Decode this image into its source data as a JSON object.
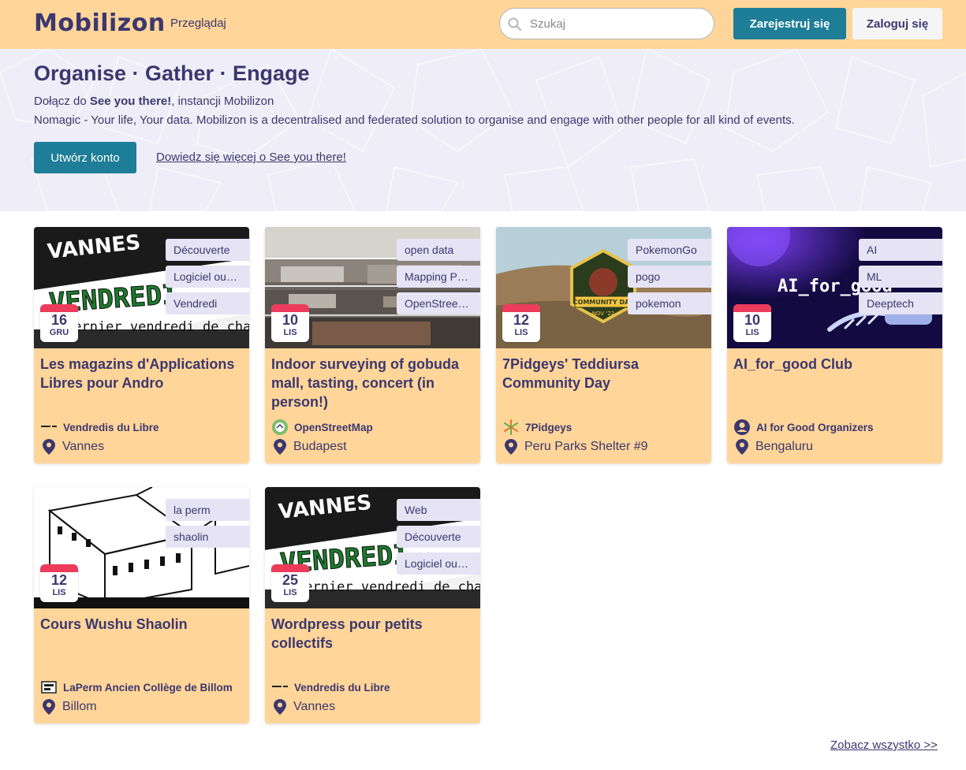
{
  "header": {
    "logo": "Mobilizon",
    "browse_label": "Przeglądaj",
    "search_placeholder": "Szukaj",
    "register_label": "Zarejestruj się",
    "login_label": "Zaloguj się"
  },
  "hero": {
    "title": "Organise · Gather · Engage",
    "join_prefix": "Dołącz do ",
    "instance_name": "See you there!",
    "join_suffix": ", instancji Mobilizon",
    "description": "Nomagic - Your life, Your data. Mobilizon is a decentralised and federated solution to organise and engage with other people for all kind of events.",
    "create_account_label": "Utwórz konto",
    "learn_more_label": "Dowiedz się więcej o See you there!"
  },
  "events": [
    {
      "title": "Les magazins d'Applications Libres pour Andro",
      "day": "16",
      "month": "GRU",
      "tags": [
        "Découverte",
        "Logiciel ou…",
        "Vendredi"
      ],
      "organizer": "Vendredis du Libre",
      "location": "Vannes",
      "image": "vendredi-banner",
      "image_text": [
        "VANNES",
        "VENDREDI",
        "dernier vendredi de chaq"
      ]
    },
    {
      "title": "Indoor surveying of gobuda mall, tasting, concert (in person!)",
      "day": "10",
      "month": "LIS",
      "tags": [
        "open data",
        "Mapping P…",
        "OpenStree…"
      ],
      "organizer": "OpenStreetMap",
      "location": "Budapest",
      "image": "mall-photo"
    },
    {
      "title": "7Pidgeys' Teddiursa Community Day",
      "day": "12",
      "month": "LIS",
      "tags": [
        "PokemonGo",
        "pogo",
        "pokemon"
      ],
      "organizer": "7Pidgeys",
      "location": "Peru Parks Shelter #9",
      "image": "community-day",
      "image_text": [
        "COMMUNITY DAY",
        "NOV '22"
      ]
    },
    {
      "title": "AI_for_good Club",
      "day": "10",
      "month": "LIS",
      "tags": [
        "AI",
        "ML",
        "Deeptech"
      ],
      "organizer": "AI for Good Organizers",
      "location": "Bengaluru",
      "image": "ai-banner",
      "image_text": [
        "AI_for_good"
      ]
    },
    {
      "title": "Cours Wushu Shaolin",
      "day": "12",
      "month": "LIS",
      "tags": [
        "la perm",
        "shaolin"
      ],
      "organizer": "LaPerm Ancien Collège de Billom",
      "location": "Billom",
      "image": "laperm-drawing"
    },
    {
      "title": "Wordpress pour petits collectifs",
      "day": "25",
      "month": "LIS",
      "tags": [
        "Web",
        "Découverte",
        "Logiciel ou…"
      ],
      "organizer": "Vendredis du Libre",
      "location": "Vannes",
      "image": "vendredi-banner",
      "image_text": [
        "VANNES",
        "VENDREDI",
        "dernier vendredi de chaq"
      ]
    }
  ],
  "see_all_label": "Zobacz wszystko >>",
  "colors": {
    "header_bg": "#ffd599",
    "primary": "#1e7d97",
    "text": "#3c376e",
    "card_bg": "#ffd599",
    "tag_bg": "#e5e3f4",
    "date_accent": "#ed3b5b",
    "hero_bg": "#efedf7"
  }
}
